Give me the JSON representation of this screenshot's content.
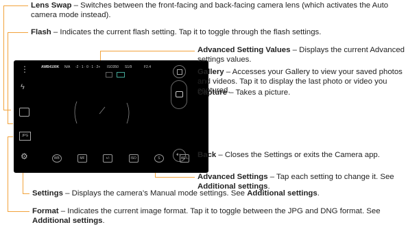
{
  "captions": {
    "lens_swap": {
      "term": "Lens Swap",
      "desc": " – Switches between the front-facing and back-facing camera lens (which activates the Auto camera mode instead)."
    },
    "flash": {
      "term": "Flash",
      "desc": " – Indicates the current flash setting. Tap it to toggle through the flash settings."
    },
    "advanced_values": {
      "term": "Advanced Setting Values",
      "desc": " – Displays the current Advanced settings values."
    },
    "gallery": {
      "term": "Gallery",
      "desc": " – Accesses your Gallery to view your saved photos and videos. Tap it to display the last photo or video you captured."
    },
    "capture": {
      "term": "Capture",
      "desc": " – Takes a picture."
    },
    "back": {
      "term": "Back",
      "desc": " – Closes the Settings or exits the Camera app."
    },
    "advanced_settings": {
      "term": "Advanced Settings",
      "desc": " – Tap each setting to change it. See ",
      "link": "Additional settings",
      "end": "."
    },
    "settings": {
      "term": "Settings",
      "desc": " – Displays the camera’s Manual mode settings. See ",
      "link": "Additional settings",
      "end": "."
    },
    "format": {
      "term": "Format",
      "desc": " – Indicates the current image format. Tap it to toggle between the JPG and DNG format. See ",
      "link": "Additional settings",
      "end": "."
    }
  },
  "screen": {
    "values": {
      "awb": "AWB4100K",
      "na": "N/A",
      "ev": "-2 · 1 · 0 · 1 · 2+",
      "iso": "ISO350",
      "shutter": "S1/9",
      "aperture": "F2.4"
    },
    "format_label": "JPG",
    "adv_icons": [
      "WB",
      "MF",
      "+/-",
      "ISO",
      "S",
      "AE-L"
    ]
  },
  "colors": {
    "leader": "#f2a23a",
    "screen": "#000000"
  }
}
